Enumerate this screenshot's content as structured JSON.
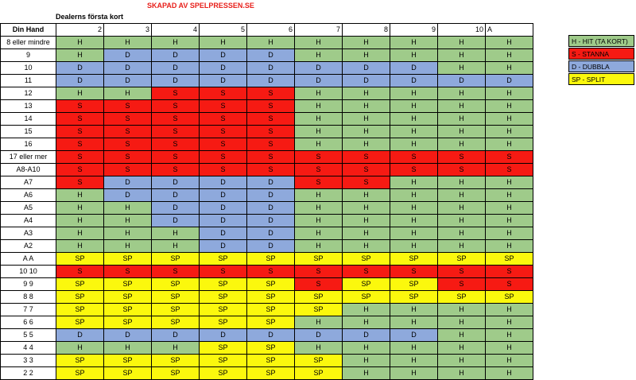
{
  "credit": "SKAPAD AV SPELPRESSEN.SE",
  "dealer_header": "Dealerns första kort",
  "corner_label": "Din Hand",
  "dealer_cards": [
    "2",
    "3",
    "4",
    "5",
    "6",
    "7",
    "8",
    "9",
    "10",
    "A"
  ],
  "rows": [
    {
      "hand": "8 eller mindre",
      "actions": [
        "H",
        "H",
        "H",
        "H",
        "H",
        "H",
        "H",
        "H",
        "H",
        "H"
      ]
    },
    {
      "hand": "9",
      "actions": [
        "H",
        "D",
        "D",
        "D",
        "D",
        "H",
        "H",
        "H",
        "H",
        "H"
      ]
    },
    {
      "hand": "10",
      "actions": [
        "D",
        "D",
        "D",
        "D",
        "D",
        "D",
        "D",
        "D",
        "H",
        "H"
      ]
    },
    {
      "hand": "11",
      "actions": [
        "D",
        "D",
        "D",
        "D",
        "D",
        "D",
        "D",
        "D",
        "D",
        "D"
      ]
    },
    {
      "hand": "12",
      "actions": [
        "H",
        "H",
        "S",
        "S",
        "S",
        "H",
        "H",
        "H",
        "H",
        "H"
      ]
    },
    {
      "hand": "13",
      "actions": [
        "S",
        "S",
        "S",
        "S",
        "S",
        "H",
        "H",
        "H",
        "H",
        "H"
      ]
    },
    {
      "hand": "14",
      "actions": [
        "S",
        "S",
        "S",
        "S",
        "S",
        "H",
        "H",
        "H",
        "H",
        "H"
      ]
    },
    {
      "hand": "15",
      "actions": [
        "S",
        "S",
        "S",
        "S",
        "S",
        "H",
        "H",
        "H",
        "H",
        "H"
      ]
    },
    {
      "hand": "16",
      "actions": [
        "S",
        "S",
        "S",
        "S",
        "S",
        "H",
        "H",
        "H",
        "H",
        "H"
      ]
    },
    {
      "hand": "17 eller mer",
      "actions": [
        "S",
        "S",
        "S",
        "S",
        "S",
        "S",
        "S",
        "S",
        "S",
        "S"
      ]
    },
    {
      "hand": "A8-A10",
      "actions": [
        "S",
        "S",
        "S",
        "S",
        "S",
        "S",
        "S",
        "S",
        "S",
        "S"
      ]
    },
    {
      "hand": "A7",
      "actions": [
        "S",
        "D",
        "D",
        "D",
        "D",
        "S",
        "S",
        "H",
        "H",
        "H"
      ]
    },
    {
      "hand": "A6",
      "actions": [
        "H",
        "D",
        "D",
        "D",
        "D",
        "H",
        "H",
        "H",
        "H",
        "H"
      ]
    },
    {
      "hand": "A5",
      "actions": [
        "H",
        "H",
        "D",
        "D",
        "D",
        "H",
        "H",
        "H",
        "H",
        "H"
      ]
    },
    {
      "hand": "A4",
      "actions": [
        "H",
        "H",
        "D",
        "D",
        "D",
        "H",
        "H",
        "H",
        "H",
        "H"
      ]
    },
    {
      "hand": "A3",
      "actions": [
        "H",
        "H",
        "H",
        "D",
        "D",
        "H",
        "H",
        "H",
        "H",
        "H"
      ]
    },
    {
      "hand": "A2",
      "actions": [
        "H",
        "H",
        "H",
        "D",
        "D",
        "H",
        "H",
        "H",
        "H",
        "H"
      ]
    },
    {
      "hand": "A A",
      "actions": [
        "SP",
        "SP",
        "SP",
        "SP",
        "SP",
        "SP",
        "SP",
        "SP",
        "SP",
        "SP"
      ]
    },
    {
      "hand": "10 10",
      "actions": [
        "S",
        "S",
        "S",
        "S",
        "S",
        "S",
        "S",
        "S",
        "S",
        "S"
      ]
    },
    {
      "hand": "9 9",
      "actions": [
        "SP",
        "SP",
        "SP",
        "SP",
        "SP",
        "S",
        "SP",
        "SP",
        "S",
        "S"
      ]
    },
    {
      "hand": "8 8",
      "actions": [
        "SP",
        "SP",
        "SP",
        "SP",
        "SP",
        "SP",
        "SP",
        "SP",
        "SP",
        "SP"
      ]
    },
    {
      "hand": "7 7",
      "actions": [
        "SP",
        "SP",
        "SP",
        "SP",
        "SP",
        "SP",
        "H",
        "H",
        "H",
        "H"
      ]
    },
    {
      "hand": "6 6",
      "actions": [
        "SP",
        "SP",
        "SP",
        "SP",
        "SP",
        "H",
        "H",
        "H",
        "H",
        "H"
      ]
    },
    {
      "hand": "5 5",
      "actions": [
        "D",
        "D",
        "D",
        "D",
        "D",
        "D",
        "D",
        "D",
        "H",
        "H"
      ]
    },
    {
      "hand": "4 4",
      "actions": [
        "H",
        "H",
        "H",
        "SP",
        "SP",
        "H",
        "H",
        "H",
        "H",
        "H"
      ]
    },
    {
      "hand": "3 3",
      "actions": [
        "SP",
        "SP",
        "SP",
        "SP",
        "SP",
        "SP",
        "H",
        "H",
        "H",
        "H"
      ]
    },
    {
      "hand": "2 2",
      "actions": [
        "SP",
        "SP",
        "SP",
        "SP",
        "SP",
        "SP",
        "H",
        "H",
        "H",
        "H"
      ]
    }
  ],
  "legend": [
    {
      "code": "H",
      "label": "H - HIT (TA KORT)",
      "color": "#9fcb8a"
    },
    {
      "code": "S",
      "label": "S - STANNA",
      "color": "#f61a13"
    },
    {
      "code": "D",
      "label": "D - DUBBLA",
      "color": "#8ea9dc"
    },
    {
      "code": "SP",
      "label": "SP - SPLIT",
      "color": "#fbf80d"
    }
  ]
}
